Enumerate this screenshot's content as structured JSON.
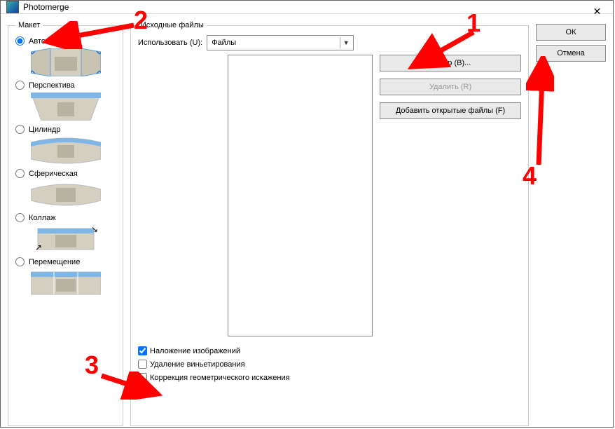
{
  "window": {
    "title": "Photomerge",
    "close_glyph": "✕"
  },
  "layout": {
    "legend": "Макет",
    "options": {
      "auto": "Авто",
      "perspective": "Перспектива",
      "cylindrical": "Цилиндр",
      "spherical": "Сферическая",
      "collage": "Коллаж",
      "reposition": "Перемещение"
    },
    "selected": "auto"
  },
  "source": {
    "legend": "Исходные файлы",
    "use_label": "Использовать (U):",
    "use_value": "Файлы",
    "browse": "Обзор (B)...",
    "remove": "Удалить (R)",
    "add_open": "Добавить открытые файлы (F)"
  },
  "checks": {
    "blend": "Наложение изображений",
    "vignette": "Удаление виньетирования",
    "geom": "Коррекция геометрического искажения"
  },
  "actions": {
    "ok": "ОК",
    "cancel": "Отмена"
  },
  "annotations": {
    "n1": "1",
    "n2": "2",
    "n3": "3",
    "n4": "4"
  },
  "colors": {
    "annotation": "#ff0000"
  }
}
